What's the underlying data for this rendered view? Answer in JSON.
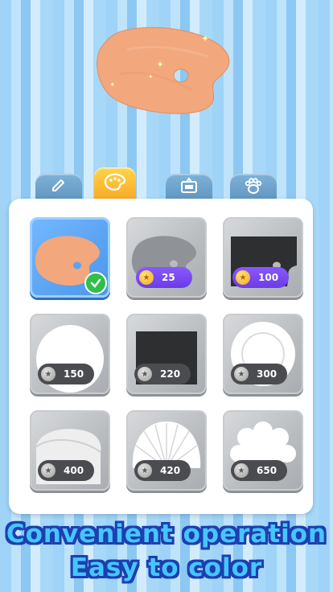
{
  "tabs": [
    {
      "icon": "pencil-icon",
      "active": false
    },
    {
      "icon": "palette-icon",
      "active": true
    },
    {
      "icon": "frame-icon",
      "active": false
    },
    {
      "icon": "paw-icon",
      "active": false
    }
  ],
  "items": [
    {
      "name": "palette",
      "selected": true,
      "price": null,
      "currency": null
    },
    {
      "name": "gray-palette",
      "selected": false,
      "price": "25",
      "currency": "gold"
    },
    {
      "name": "black-palette",
      "selected": false,
      "price": "100",
      "currency": "gold"
    },
    {
      "name": "white-round-plate",
      "selected": false,
      "price": "150",
      "currency": "silver"
    },
    {
      "name": "black-square-plate",
      "selected": false,
      "price": "220",
      "currency": "silver"
    },
    {
      "name": "white-dish",
      "selected": false,
      "price": "300",
      "currency": "silver"
    },
    {
      "name": "round-plate",
      "selected": false,
      "price": "400",
      "currency": "silver"
    },
    {
      "name": "shell-plate",
      "selected": false,
      "price": "420",
      "currency": "silver"
    },
    {
      "name": "paw-plate",
      "selected": false,
      "price": "650",
      "currency": "silver"
    }
  ],
  "caption": {
    "line1": "Convenient operation",
    "line2": "Easy to color"
  },
  "colors": {
    "accent_tab": "#f9a825",
    "selected_card": "#4a95ea",
    "buy_badge": "#6a3ce6",
    "caption_fill": "#46c6ff",
    "caption_outline": "#1d3fb0"
  }
}
